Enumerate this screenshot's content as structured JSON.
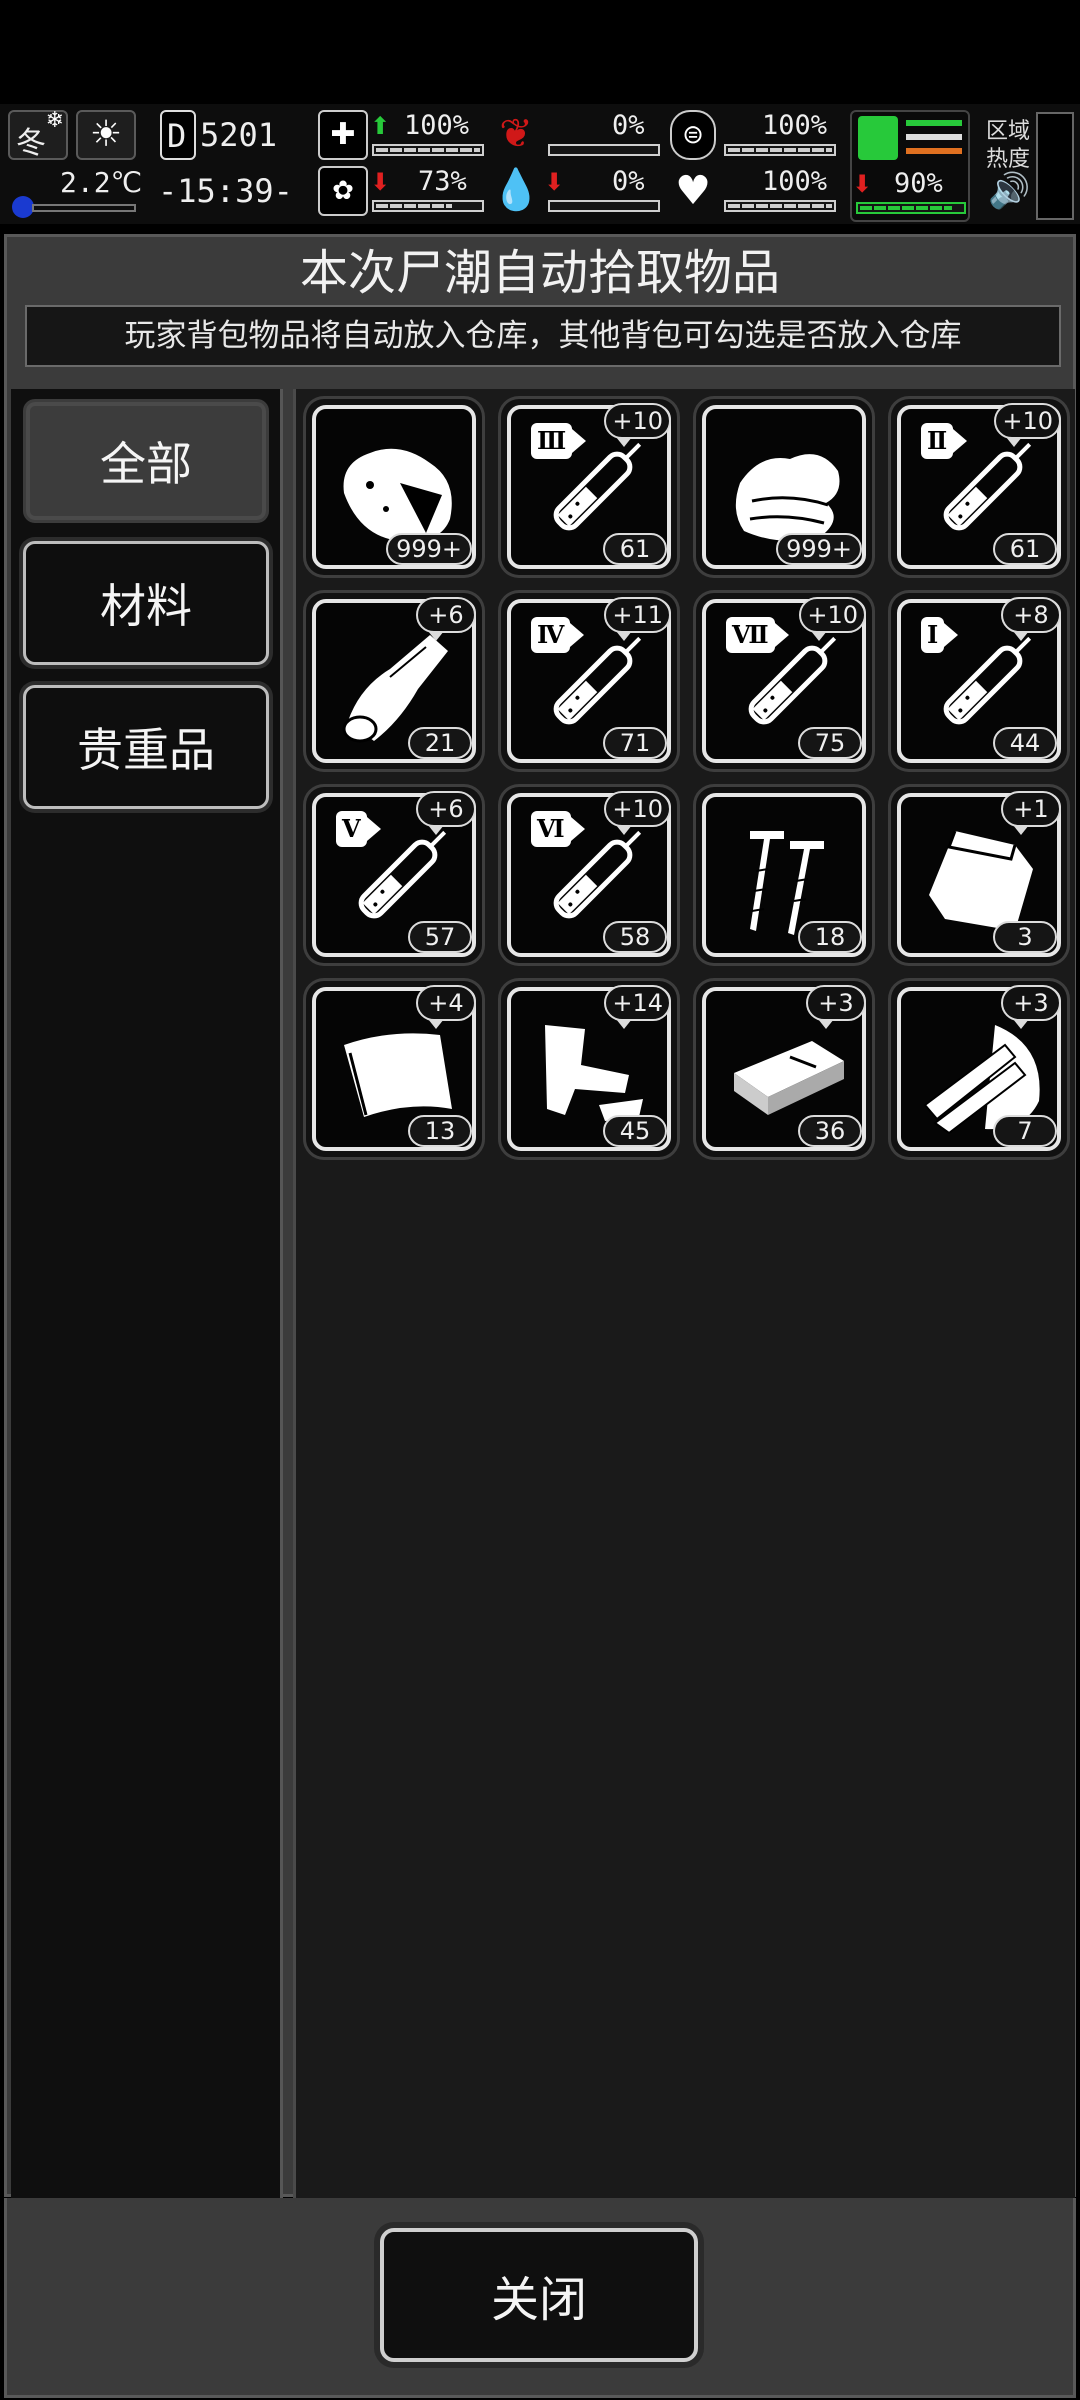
{
  "status": {
    "season": "冬",
    "temperature": "2.2℃",
    "day": "5201",
    "day_prefix": "D",
    "time": "-15:39-",
    "health_pct": "100%",
    "sanity_pct": "73%",
    "hunger_pct": "0%",
    "blood_pct": "0%",
    "thirst_pct": "100%",
    "heart_pct": "100%",
    "stamina_pct": "90%",
    "zone_heat_label": "区域\n热度",
    "icons": {
      "weather": "snowflake-icon",
      "sun": "sun-icon",
      "health": "medkit-icon",
      "sanity": "brain-icon",
      "hunger": "stomach-icon",
      "blood": "blood-drop-icon",
      "thirst": "water-bottle-icon",
      "heart": "heart-icon",
      "stamina": "boot-icon",
      "sound": "speaker-icon"
    },
    "colors": {
      "up": "#27c93a",
      "down": "#e02020",
      "red_icon": "#d01818"
    }
  },
  "dialog": {
    "title": "本次尸潮自动拾取物品",
    "notice": "玩家背包物品将自动放入仓库，其他背包可勾选是否放入仓库"
  },
  "categories": [
    {
      "label": "全部",
      "active": true
    },
    {
      "label": "材料",
      "active": false
    },
    {
      "label": "贵重品",
      "active": false
    }
  ],
  "items": [
    {
      "icon": "meat-chunk-icon",
      "count": "999+",
      "bonus": ""
    },
    {
      "icon": "syringe-icon",
      "tier": "Ⅲ",
      "count": "61",
      "bonus": "+10"
    },
    {
      "icon": "cloth-rags-icon",
      "count": "999+",
      "bonus": ""
    },
    {
      "icon": "syringe-icon",
      "tier": "Ⅱ",
      "count": "61",
      "bonus": "+10"
    },
    {
      "icon": "wood-log-icon",
      "count": "21",
      "bonus": "+6"
    },
    {
      "icon": "syringe-icon",
      "tier": "Ⅳ",
      "count": "71",
      "bonus": "+11"
    },
    {
      "icon": "syringe-icon",
      "tier": "Ⅶ",
      "count": "75",
      "bonus": "+10"
    },
    {
      "icon": "syringe-icon",
      "tier": "Ⅰ",
      "count": "44",
      "bonus": "+8"
    },
    {
      "icon": "syringe-icon",
      "tier": "Ⅴ",
      "count": "57",
      "bonus": "+6"
    },
    {
      "icon": "syringe-icon",
      "tier": "Ⅵ",
      "count": "58",
      "bonus": "+10"
    },
    {
      "icon": "screws-icon",
      "count": "18",
      "bonus": ""
    },
    {
      "icon": "plastic-bag-icon",
      "count": "3",
      "bonus": "+1"
    },
    {
      "icon": "paper-sheet-icon",
      "count": "13",
      "bonus": "+4"
    },
    {
      "icon": "scrap-metal-icon",
      "count": "45",
      "bonus": "+14"
    },
    {
      "icon": "wood-plank-icon",
      "count": "36",
      "bonus": "+3"
    },
    {
      "icon": "wood-planks-bundle-icon",
      "count": "7",
      "bonus": "+3"
    }
  ],
  "footer": {
    "close_label": "关闭"
  }
}
